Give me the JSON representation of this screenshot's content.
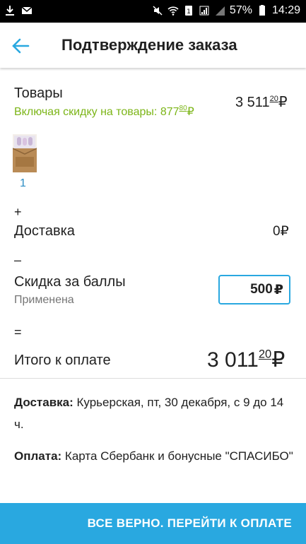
{
  "status_bar": {
    "battery": "57%",
    "time": "14:29"
  },
  "header": {
    "title": "Подтверждение заказа"
  },
  "goods": {
    "label": "Товары",
    "discount_text": "Включая скидку на товары: 877",
    "discount_kopecks": "80",
    "currency": "₽",
    "amount_rub": "3 511",
    "amount_kop": "20",
    "item_quantity": "1"
  },
  "ops": {
    "plus": "+",
    "minus": "–",
    "equals": "="
  },
  "delivery": {
    "label": "Доставка",
    "amount": "0"
  },
  "points": {
    "label": "Скидка за баллы",
    "status": "Применена",
    "value": "500"
  },
  "total": {
    "label": "Итого к оплате",
    "amount_rub": "3 011",
    "amount_kop": "20"
  },
  "info": {
    "delivery_title": "Доставка:",
    "delivery_text": " Курьерская, пт, 30 декабря, с 9 до 14 ч.",
    "payment_title": "Оплата:",
    "payment_text": " Карта Сбербанк и бонусные \"СПАСИБО\""
  },
  "cta": {
    "label": "ВСЕ ВЕРНО. ПЕРЕЙТИ К ОПЛАТЕ"
  }
}
